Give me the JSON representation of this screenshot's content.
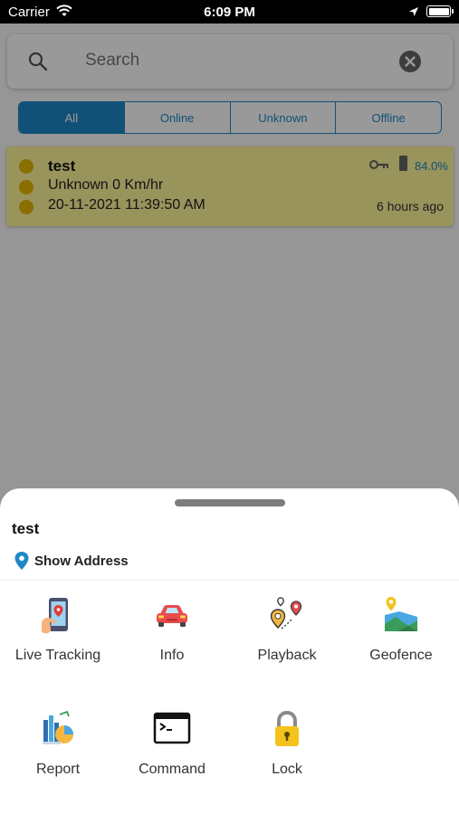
{
  "status_bar": {
    "carrier": "Carrier",
    "time": "6:09 PM"
  },
  "search": {
    "placeholder": "Search"
  },
  "filters": [
    {
      "label": "All",
      "active": true
    },
    {
      "label": "Online",
      "active": false
    },
    {
      "label": "Unknown",
      "active": false
    },
    {
      "label": "Offline",
      "active": false
    }
  ],
  "device": {
    "name": "test",
    "status": "Unknown 0 Km/hr",
    "datetime": "20-11-2021 11:39:50 AM",
    "battery": "84.0%",
    "ago": "6 hours ago",
    "card_color": "#fff59a"
  },
  "sheet": {
    "title": "test",
    "address_label": "Show Address",
    "actions": [
      {
        "label": "Live Tracking",
        "icon": "live-tracking-icon"
      },
      {
        "label": "Info",
        "icon": "car-icon"
      },
      {
        "label": "Playback",
        "icon": "playback-route-icon"
      },
      {
        "label": "Geofence",
        "icon": "geofence-map-icon"
      },
      {
        "label": "Report",
        "icon": "report-chart-icon"
      },
      {
        "label": "Command",
        "icon": "terminal-icon"
      },
      {
        "label": "Lock",
        "icon": "lock-icon"
      }
    ]
  },
  "colors": {
    "accent": "#1e88c7",
    "overlay": "rgba(0,0,0,0.4)"
  }
}
